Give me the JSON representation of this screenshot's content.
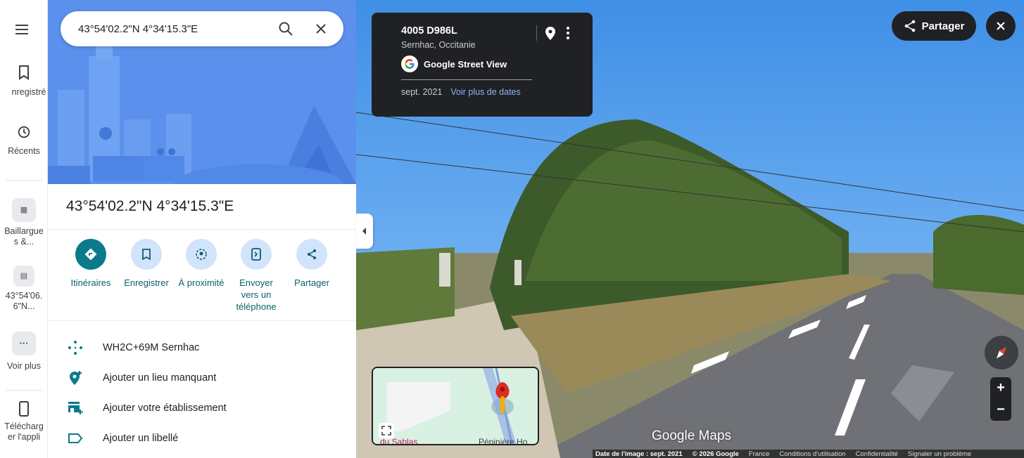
{
  "rail": {
    "items": [
      {
        "label": "nregistré"
      },
      {
        "label": "Récents"
      },
      {
        "label": "Baillargues &...",
        "line1": "Baillargue",
        "line2": "s &..."
      },
      {
        "label": "43°54'06.6\"N...",
        "line1": "43°54'06.",
        "line2": "6\"N..."
      },
      {
        "label": "Voir plus"
      },
      {
        "label": "Télécharger l'appli",
        "line1": "Télécharg",
        "line2": "er l'appli"
      }
    ]
  },
  "search": {
    "value": "43°54'02.2\"N 4°34'15.3\"E"
  },
  "place": {
    "title": "43°54'02.2\"N 4°34'15.3\"E"
  },
  "actions": [
    {
      "label": "Itinéraires"
    },
    {
      "label": "Enregistrer"
    },
    {
      "label": "À proximité"
    },
    {
      "label": "Envoyer vers un téléphone",
      "line1": "Envoyer",
      "line2": "vers un",
      "line3": "téléphone"
    },
    {
      "label": "Partager"
    }
  ],
  "info": {
    "plus_code": "WH2C+69M Sernhac",
    "add_missing": "Ajouter un lieu manquant",
    "add_business": "Ajouter votre établissement",
    "add_label": "Ajouter un libellé"
  },
  "streetview": {
    "address": "4005 D986L",
    "locality": "Sernhac, Occitanie",
    "brand": "Google Street View",
    "date": "sept. 2021",
    "more_dates": "Voir plus de dates",
    "share": "Partager",
    "watermark": "Google Maps",
    "minimap_label_1": "du Sablas",
    "minimap_label_2": "Pépinière Ho"
  },
  "footer": {
    "image_date": "Date de l'image : sept. 2021",
    "copyright": "© 2026 Google",
    "country": "France",
    "terms": "Conditions d'utilisation",
    "privacy": "Confidentialité",
    "report": "Signaler un problème"
  },
  "colors": {
    "accent": "#0b7a8a",
    "hero": "#5d92ee",
    "dark": "#202124"
  }
}
